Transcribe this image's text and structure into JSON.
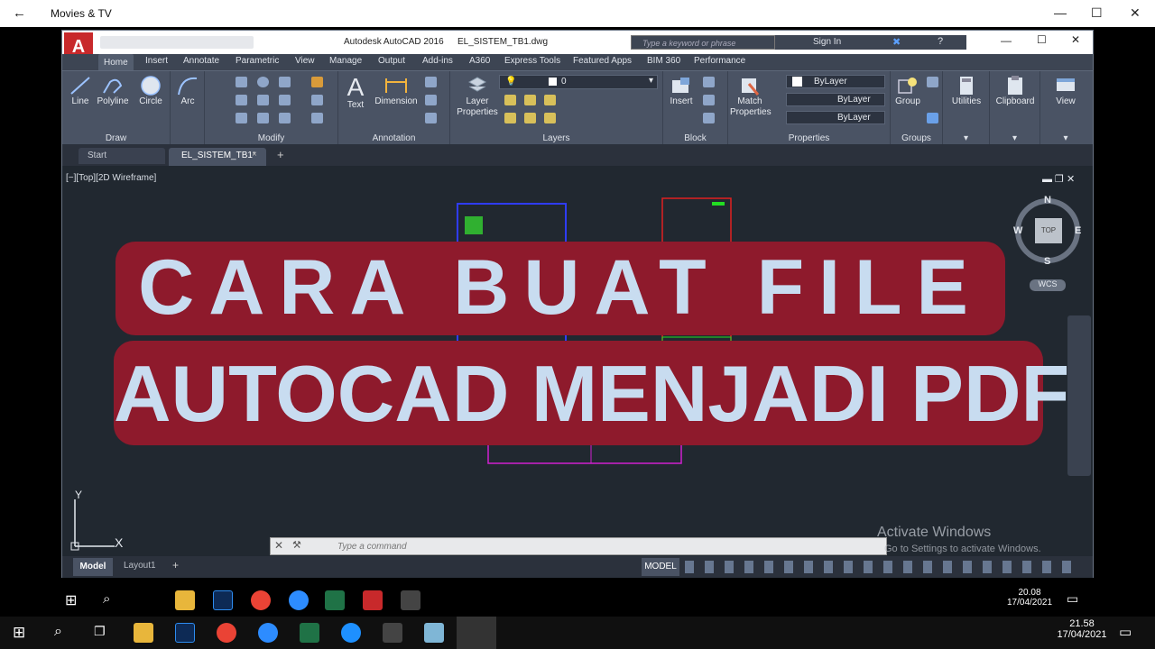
{
  "outer_window": {
    "back_icon": "←",
    "title": "Movies & TV",
    "minimize": "—",
    "maximize": "☐",
    "close": "✕"
  },
  "acad": {
    "title_center": "Autodesk AutoCAD 2016",
    "file_name": "EL_SISTEM_TB1.dwg",
    "search_placeholder": "Type a keyword or phrase",
    "sign_in": "Sign In",
    "app_letter": "A",
    "tabs": [
      "Home",
      "Insert",
      "Annotate",
      "Parametric",
      "View",
      "Manage",
      "Output",
      "Add-ins",
      "A360",
      "Express Tools",
      "Featured Apps",
      "BIM 360",
      "Performance"
    ],
    "draw_tools": {
      "line": "Line",
      "polyline": "Polyline",
      "circle": "Circle",
      "arc": "Arc"
    },
    "annotation_tools": {
      "text": "Text",
      "dimension": "Dimension"
    },
    "layer_props": [
      "Layer",
      "Properties"
    ],
    "layer_current": "0",
    "block_tools": {
      "insert": "Insert"
    },
    "match_props": [
      "Match",
      "Properties"
    ],
    "bylayer": [
      "ByLayer",
      "ByLayer",
      "ByLayer"
    ],
    "group": "Group",
    "utilities": "Utilities",
    "clipboard": "Clipboard",
    "view": "View",
    "panels": {
      "draw": "Draw",
      "modify": "Modify",
      "annotation": "Annotation",
      "layers": "Layers",
      "block": "Block",
      "properties": "Properties",
      "groups": "Groups"
    },
    "file_tabs": {
      "start": "Start",
      "current": "EL_SISTEM_TB1*"
    },
    "viewport_label": "[−][Top][2D Wireframe]",
    "viewcube": {
      "n": "N",
      "s": "S",
      "e": "E",
      "w": "W",
      "top": "TOP",
      "wcs": "WCS"
    },
    "ucs": {
      "x": "X",
      "y": "Y"
    },
    "command_placeholder": "Type a command",
    "layout_tabs": {
      "model": "Model",
      "layout1": "Layout1"
    },
    "status_model": "MODEL"
  },
  "overlay": {
    "line1": "CARA  BUAT  FILE",
    "line2": "AUTOCAD MENJADI PDF"
  },
  "activate": {
    "title": "Activate Windows",
    "sub": "Go to Settings to activate Windows."
  },
  "inner_clock": {
    "time": "20.08",
    "date": "17/04/2021"
  },
  "outer_clock": {
    "time": "21.58",
    "date": "17/04/2021"
  },
  "colors": {
    "overlay_red": "#8e1a2c",
    "overlay_text": "#c8dcf0",
    "acad_dark": "#212830"
  }
}
